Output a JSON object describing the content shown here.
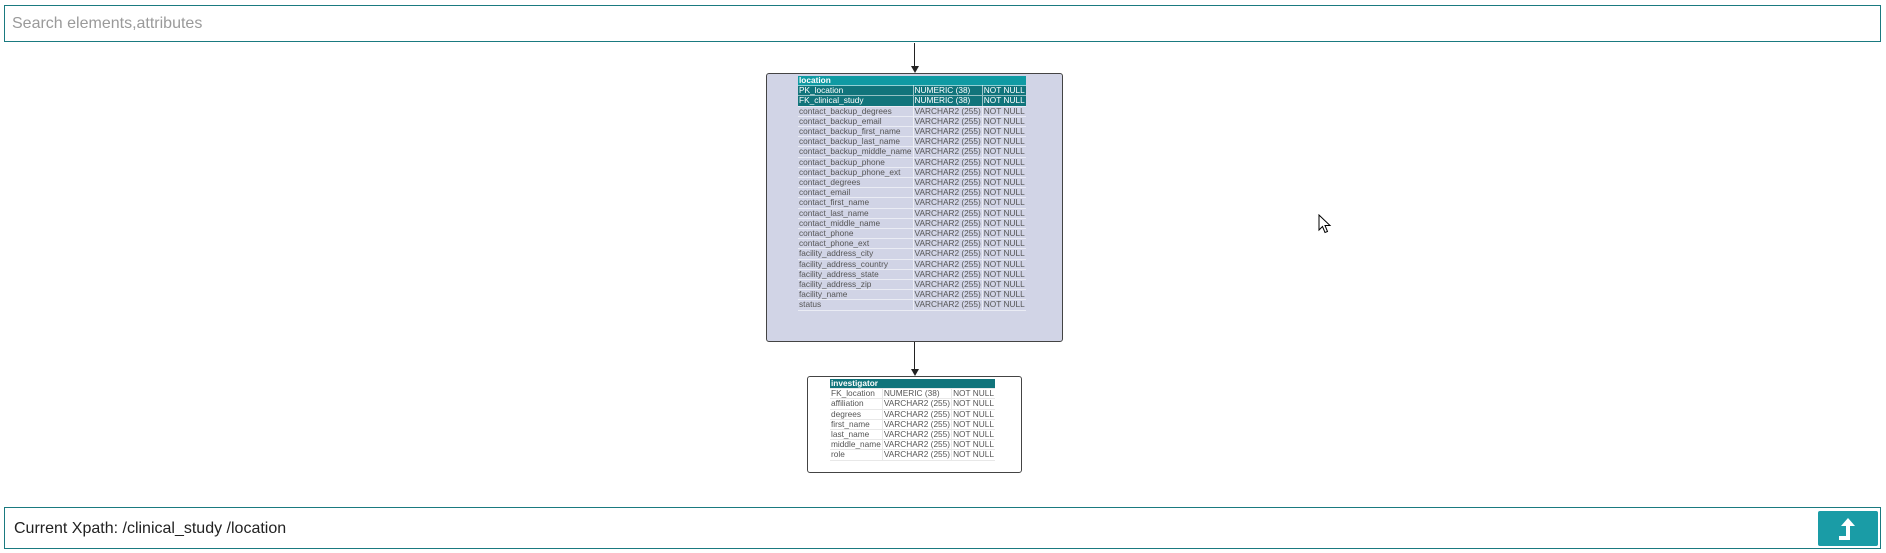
{
  "search": {
    "placeholder": "Search elements,attributes",
    "value": ""
  },
  "nodes": {
    "location": {
      "title": "location",
      "rows": [
        {
          "name": "PK_location",
          "type": "NUMERIC (38)",
          "null": "NOT NULL",
          "key": true
        },
        {
          "name": "FK_clinical_study",
          "type": "NUMERIC (38)",
          "null": "NOT NULL",
          "key": true
        },
        {
          "name": "contact_backup_degrees",
          "type": "VARCHAR2 (255)",
          "null": "NOT NULL"
        },
        {
          "name": "contact_backup_email",
          "type": "VARCHAR2 (255)",
          "null": "NOT NULL"
        },
        {
          "name": "contact_backup_first_name",
          "type": "VARCHAR2 (255)",
          "null": "NOT NULL"
        },
        {
          "name": "contact_backup_last_name",
          "type": "VARCHAR2 (255)",
          "null": "NOT NULL"
        },
        {
          "name": "contact_backup_middle_name",
          "type": "VARCHAR2 (255)",
          "null": "NOT NULL"
        },
        {
          "name": "contact_backup_phone",
          "type": "VARCHAR2 (255)",
          "null": "NOT NULL"
        },
        {
          "name": "contact_backup_phone_ext",
          "type": "VARCHAR2 (255)",
          "null": "NOT NULL"
        },
        {
          "name": "contact_degrees",
          "type": "VARCHAR2 (255)",
          "null": "NOT NULL"
        },
        {
          "name": "contact_email",
          "type": "VARCHAR2 (255)",
          "null": "NOT NULL"
        },
        {
          "name": "contact_first_name",
          "type": "VARCHAR2 (255)",
          "null": "NOT NULL"
        },
        {
          "name": "contact_last_name",
          "type": "VARCHAR2 (255)",
          "null": "NOT NULL"
        },
        {
          "name": "contact_middle_name",
          "type": "VARCHAR2 (255)",
          "null": "NOT NULL"
        },
        {
          "name": "contact_phone",
          "type": "VARCHAR2 (255)",
          "null": "NOT NULL"
        },
        {
          "name": "contact_phone_ext",
          "type": "VARCHAR2 (255)",
          "null": "NOT NULL"
        },
        {
          "name": "facility_address_city",
          "type": "VARCHAR2 (255)",
          "null": "NOT NULL"
        },
        {
          "name": "facility_address_country",
          "type": "VARCHAR2 (255)",
          "null": "NOT NULL"
        },
        {
          "name": "facility_address_state",
          "type": "VARCHAR2 (255)",
          "null": "NOT NULL"
        },
        {
          "name": "facility_address_zip",
          "type": "VARCHAR2 (255)",
          "null": "NOT NULL"
        },
        {
          "name": "facility_name",
          "type": "VARCHAR2 (255)",
          "null": "NOT NULL"
        },
        {
          "name": "status",
          "type": "VARCHAR2 (255)",
          "null": "NOT NULL"
        }
      ]
    },
    "investigator": {
      "title": "investigator",
      "rows": [
        {
          "name": "FK_location",
          "type": "NUMERIC (38)",
          "null": "NOT NULL"
        },
        {
          "name": "affiliation",
          "type": "VARCHAR2 (255)",
          "null": "NOT NULL"
        },
        {
          "name": "degrees",
          "type": "VARCHAR2 (255)",
          "null": "NOT NULL"
        },
        {
          "name": "first_name",
          "type": "VARCHAR2 (255)",
          "null": "NOT NULL"
        },
        {
          "name": "last_name",
          "type": "VARCHAR2 (255)",
          "null": "NOT NULL"
        },
        {
          "name": "middle_name",
          "type": "VARCHAR2 (255)",
          "null": "NOT NULL"
        },
        {
          "name": "role",
          "type": "VARCHAR2 (255)",
          "null": "NOT NULL"
        }
      ]
    }
  },
  "xpath": {
    "label": "Current Xpath: /clinical_study /location"
  },
  "icons": {
    "up": "arrow-up-icon",
    "cursor": "mouse-cursor-icon"
  },
  "colors": {
    "accent": "#1a9ca6",
    "header": "#0f9aa3",
    "key_row": "#11747b",
    "node_fill": "#d1d4e6",
    "border": "#1a7a80"
  }
}
